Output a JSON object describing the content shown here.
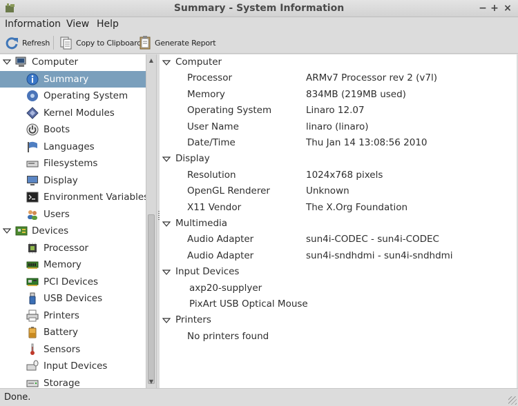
{
  "window": {
    "title": "Summary - System Information",
    "controls": [
      "−",
      "+",
      "×"
    ]
  },
  "menu": [
    "Information",
    "View",
    "Help"
  ],
  "toolbar": {
    "refresh": "Refresh",
    "copy": "Copy to Clipboard",
    "report": "Generate Report"
  },
  "sidebar": [
    {
      "label": "Computer",
      "level": 0,
      "icon": "computer-icon"
    },
    {
      "label": "Summary",
      "level": 1,
      "icon": "info-icon",
      "selected": true
    },
    {
      "label": "Operating System",
      "level": 1,
      "icon": "os-icon"
    },
    {
      "label": "Kernel Modules",
      "level": 1,
      "icon": "kernel-icon"
    },
    {
      "label": "Boots",
      "level": 1,
      "icon": "power-icon"
    },
    {
      "label": "Languages",
      "level": 1,
      "icon": "flag-icon"
    },
    {
      "label": "Filesystems",
      "level": 1,
      "icon": "drive-icon"
    },
    {
      "label": "Display",
      "level": 1,
      "icon": "monitor-icon"
    },
    {
      "label": "Environment Variables",
      "level": 1,
      "icon": "terminal-icon"
    },
    {
      "label": "Users",
      "level": 1,
      "icon": "users-icon"
    },
    {
      "label": "Devices",
      "level": 0,
      "icon": "board-icon"
    },
    {
      "label": "Processor",
      "level": 1,
      "icon": "cpu-icon"
    },
    {
      "label": "Memory",
      "level": 1,
      "icon": "memory-icon"
    },
    {
      "label": "PCI Devices",
      "level": 1,
      "icon": "pci-icon"
    },
    {
      "label": "USB Devices",
      "level": 1,
      "icon": "usb-icon"
    },
    {
      "label": "Printers",
      "level": 1,
      "icon": "printer-icon"
    },
    {
      "label": "Battery",
      "level": 1,
      "icon": "battery-icon"
    },
    {
      "label": "Sensors",
      "level": 1,
      "icon": "thermometer-icon"
    },
    {
      "label": "Input Devices",
      "level": 1,
      "icon": "input-icon"
    },
    {
      "label": "Storage",
      "level": 1,
      "icon": "storage-icon"
    }
  ],
  "details": {
    "computer": {
      "title": "Computer",
      "rows": [
        {
          "k": "Processor",
          "v": "ARMv7 Processor rev 2 (v7l)"
        },
        {
          "k": "Memory",
          "v": "834MB (219MB used)"
        },
        {
          "k": "Operating System",
          "v": "Linaro 12.07"
        },
        {
          "k": "User Name",
          "v": "linaro (linaro)"
        },
        {
          "k": "Date/Time",
          "v": "Thu Jan 14 13:08:56 2010"
        }
      ]
    },
    "display": {
      "title": "Display",
      "rows": [
        {
          "k": "Resolution",
          "v": "1024x768 pixels"
        },
        {
          "k": "OpenGL Renderer",
          "v": "Unknown"
        },
        {
          "k": "X11 Vendor",
          "v": "The X.Org Foundation"
        }
      ]
    },
    "multimedia": {
      "title": "Multimedia",
      "rows": [
        {
          "k": "Audio Adapter",
          "v": "sun4i-CODEC - sun4i-CODEC"
        },
        {
          "k": "Audio Adapter",
          "v": "sun4i-sndhdmi - sun4i-sndhdmi"
        }
      ]
    },
    "input": {
      "title": "Input Devices",
      "rows": [
        {
          "k": "axp20-supplyer",
          "v": ""
        },
        {
          "k": "PixArt USB Optical Mouse",
          "v": ""
        }
      ]
    },
    "printers": {
      "title": "Printers",
      "rows": [
        {
          "k": "No printers found",
          "v": ""
        }
      ]
    }
  },
  "status": "Done."
}
